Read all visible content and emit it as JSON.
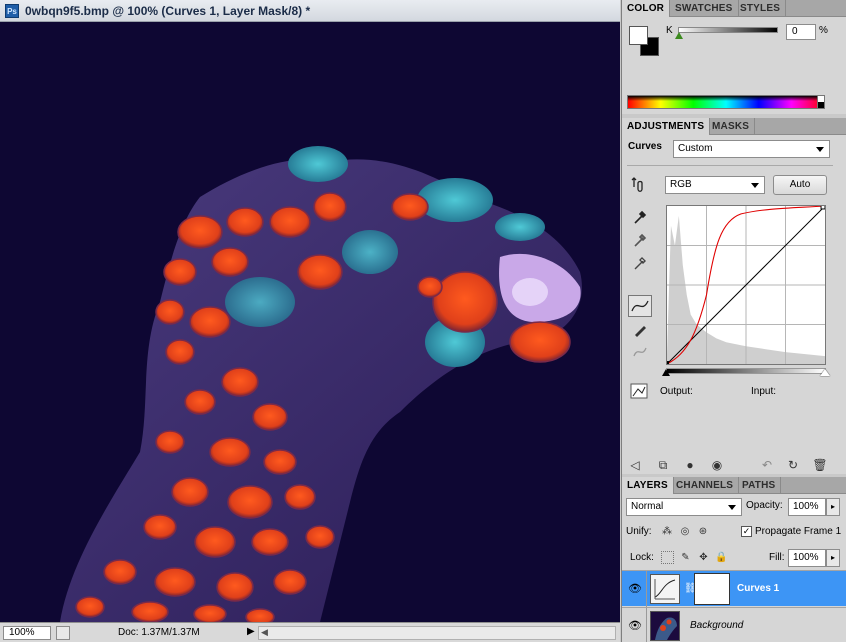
{
  "document": {
    "title": "0wbqn9f5.bmp @ 100% (Curves 1, Layer Mask/8) *",
    "app_icon": "Ps",
    "zoom": "100%",
    "doc_size": "Doc: 1.37M/1.37M",
    "background_color": "#0e0733"
  },
  "color_panel": {
    "tabs": [
      "COLOR",
      "SWATCHES",
      "STYLES"
    ],
    "active_tab": "COLOR",
    "channel_label": "K",
    "channel_value": "0",
    "unit": "%",
    "foreground": "#ffffff",
    "background": "#000000"
  },
  "adjustments_panel": {
    "tabs": [
      "ADJUSTMENTS",
      "MASKS"
    ],
    "active_tab": "ADJUSTMENTS",
    "adjustment_name": "Curves",
    "preset": "Custom",
    "channel": "RGB",
    "auto_label": "Auto",
    "output_label": "Output:",
    "input_label": "Input:",
    "curve_color": "#e00000"
  },
  "layers_panel": {
    "tabs": [
      "LAYERS",
      "CHANNELS",
      "PATHS"
    ],
    "active_tab": "LAYERS",
    "blend_mode": "Normal",
    "opacity_label": "Opacity:",
    "opacity": "100%",
    "unify_label": "Unify:",
    "propagate_label": "Propagate Frame 1",
    "propagate_checked": "✓",
    "lock_label": "Lock:",
    "fill_label": "Fill:",
    "fill": "100%",
    "selected_color": "#3d95f5",
    "layers": [
      {
        "name": "Curves 1",
        "selected": true
      },
      {
        "name": "Background",
        "selected": false
      }
    ]
  }
}
